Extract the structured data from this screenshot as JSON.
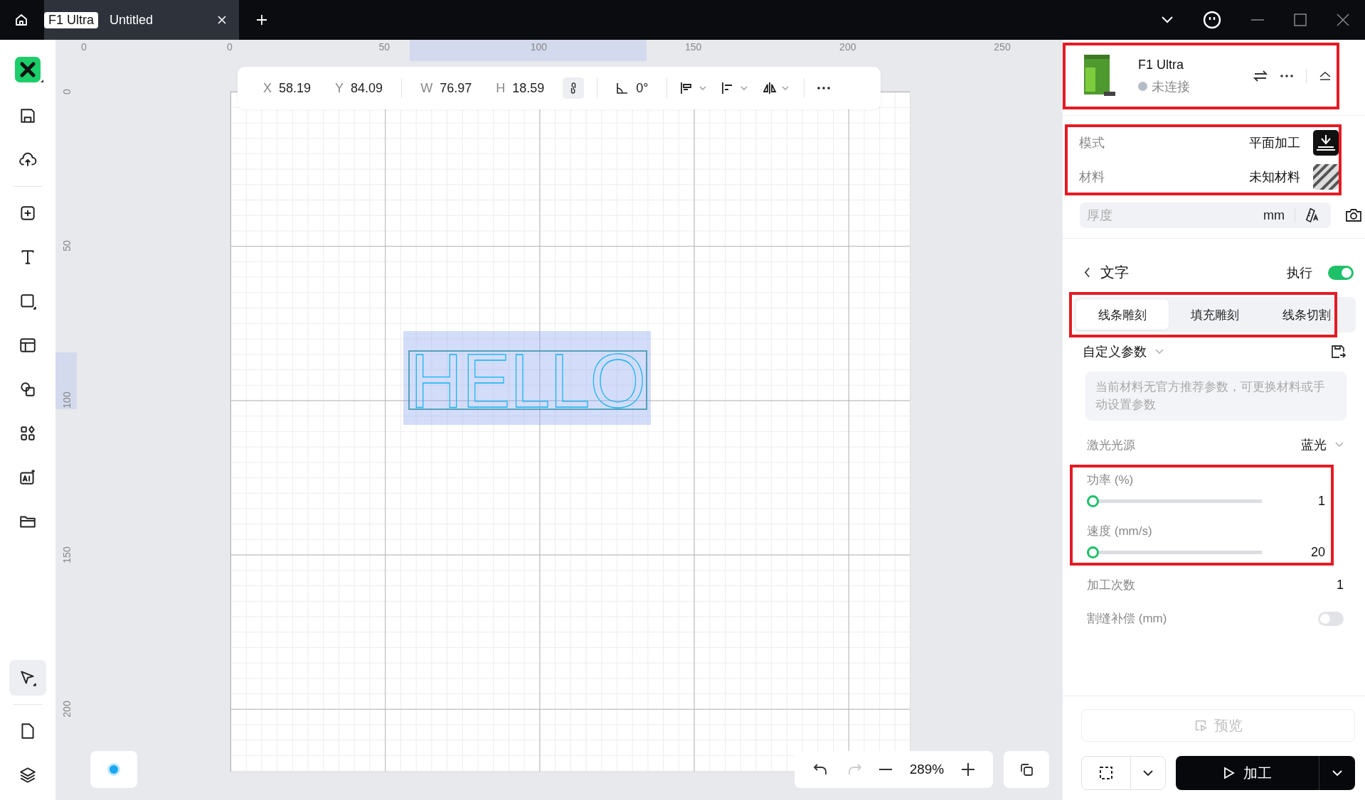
{
  "titlebar": {
    "tab": {
      "badge": "F1 Ultra",
      "title": "Untitled",
      "selected": true
    }
  },
  "sidebar": {
    "tools": [
      {
        "kind": "save",
        "selected": false
      },
      {
        "kind": "upload",
        "selected": false
      },
      {
        "kind": "add",
        "selected": false
      },
      {
        "kind": "text",
        "selected": false
      },
      {
        "kind": "rect",
        "selected": false
      },
      {
        "kind": "layout",
        "selected": false
      },
      {
        "kind": "shapes",
        "selected": false
      },
      {
        "kind": "apps",
        "selected": false
      },
      {
        "kind": "ai",
        "selected": false
      },
      {
        "kind": "folder",
        "selected": false
      }
    ],
    "bottom_tools": [
      {
        "kind": "pointer",
        "selected": true
      },
      {
        "kind": "page",
        "selected": false
      },
      {
        "kind": "layers",
        "selected": false
      }
    ]
  },
  "ruler_top": {
    "labels": [
      "0",
      "0",
      "50",
      "100",
      "150",
      "200",
      "250"
    ]
  },
  "ruler_left": {
    "labels": [
      "0",
      "50",
      "100",
      "150",
      "200"
    ]
  },
  "toolbar": {
    "fields": [
      {
        "label": "X",
        "value": "58.19"
      },
      {
        "label": "Y",
        "value": "84.09"
      },
      {
        "label": "W",
        "value": "76.97"
      },
      {
        "label": "H",
        "value": "18.59"
      }
    ],
    "lock_ratio": true,
    "angle": "0°"
  },
  "canvas": {
    "text_object": "HELLO",
    "selected": true
  },
  "zoom": {
    "undo_disabled": false,
    "redo_disabled": true,
    "value": "289%"
  },
  "device": {
    "name": "F1 Ultra",
    "status": "未连接",
    "highlighted": true
  },
  "settings": {
    "highlighted": true,
    "rows": [
      {
        "kind": "mode",
        "label": "模式",
        "value": "平面加工"
      },
      {
        "kind": "material",
        "label": "材料",
        "value": "未知材料"
      }
    ]
  },
  "thickness": {
    "placeholder": "厚度",
    "unit": "mm"
  },
  "layer": {
    "title": "文字",
    "execute_label": "执行",
    "execute_on": true
  },
  "process_tabs": {
    "highlighted": true,
    "tabs": [
      {
        "label": "线条雕刻",
        "selected": true
      },
      {
        "label": "填充雕刻",
        "selected": false
      },
      {
        "label": "线条切割",
        "selected": false
      }
    ]
  },
  "preset": "自定义参数",
  "notice": "当前材料无官方推荐参数，可更换材料或手动设置参数",
  "laser": {
    "label": "激光光源",
    "value": "蓝光"
  },
  "sliders": {
    "highlighted": true,
    "items": [
      {
        "label": "功率 (%)",
        "level": 0,
        "reading": "1"
      },
      {
        "label": "速度 (mm/s)",
        "level": 0,
        "reading": "20"
      }
    ]
  },
  "passes": {
    "label": "加工次数",
    "value": "1"
  },
  "kerf": {
    "label": "割缝补偿 (mm)",
    "on": false
  },
  "actions": {
    "preview": "预览",
    "preview_disabled": true,
    "process": "加工"
  }
}
